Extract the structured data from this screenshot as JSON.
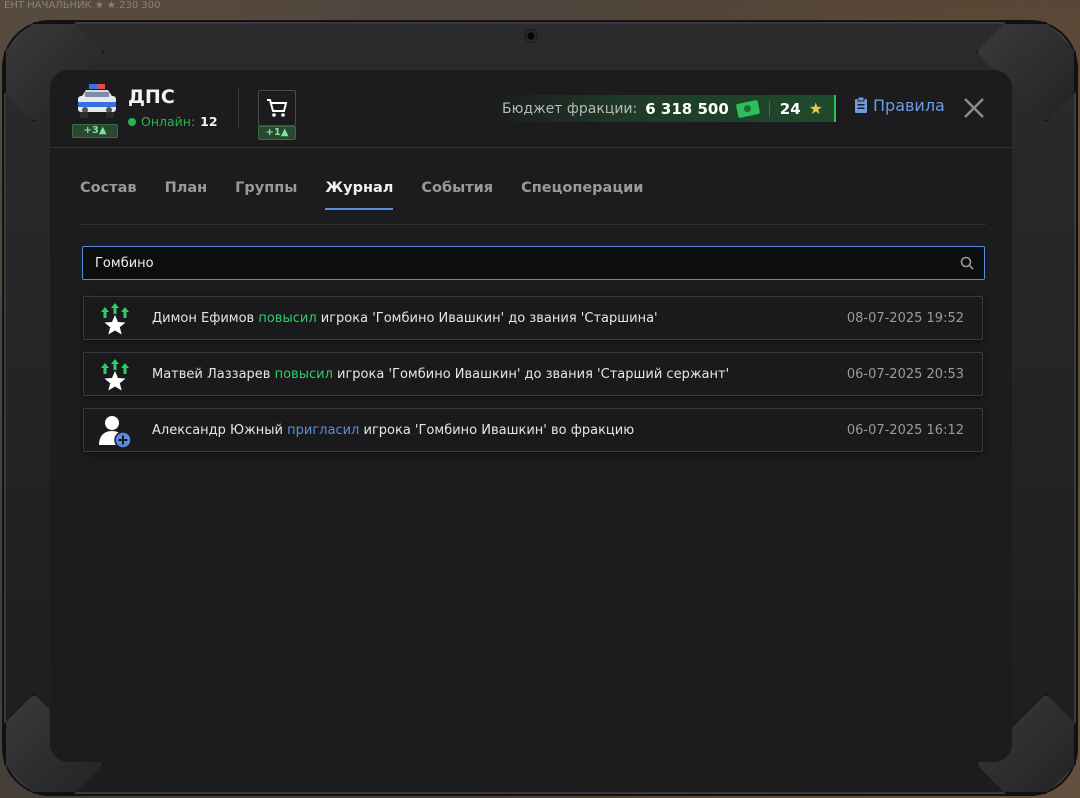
{
  "background": {
    "text": "ЕНТ НАЧАЛЬНИК  ★ ★ 230 300"
  },
  "header": {
    "faction_name": "ДПС",
    "faction_badge": "+3▲",
    "online_label": "Онлайн:",
    "online_count": "12",
    "shop_badge": "+1▲",
    "budget_label": "Бюджет фракции:",
    "budget_value": "6 318 500",
    "stars_value": "24",
    "rules_label": "Правила"
  },
  "tabs": [
    {
      "label": "Состав",
      "active": false
    },
    {
      "label": "План",
      "active": false
    },
    {
      "label": "Группы",
      "active": false
    },
    {
      "label": "Журнал",
      "active": true
    },
    {
      "label": "События",
      "active": false
    },
    {
      "label": "Спецоперации",
      "active": false
    }
  ],
  "search": {
    "value": "Гомбино"
  },
  "log": [
    {
      "icon": "rank-up-icon",
      "actor": "Димон Ефимов",
      "action": "повысил",
      "action_type": "promote",
      "rest": "игрока 'Гомбино Ивашкин' до звания 'Старшина'",
      "time": "08-07-2025 19:52"
    },
    {
      "icon": "rank-up-icon",
      "actor": "Матвей Лаззарев",
      "action": "повысил",
      "action_type": "promote",
      "rest": "игрока 'Гомбино Ивашкин' до звания 'Старший сержант'",
      "time": "06-07-2025 20:53"
    },
    {
      "icon": "invite-user-icon",
      "actor": "Александр Южный",
      "action": "пригласил",
      "action_type": "invite",
      "rest": "игрока 'Гомбино Ивашкин' во фракцию",
      "time": "06-07-2025 16:12"
    }
  ],
  "colors": {
    "accent_blue": "#5a8de0",
    "promote_green": "#2ecc6a",
    "online_green": "#27b44f",
    "star_gold": "#f4c542"
  }
}
